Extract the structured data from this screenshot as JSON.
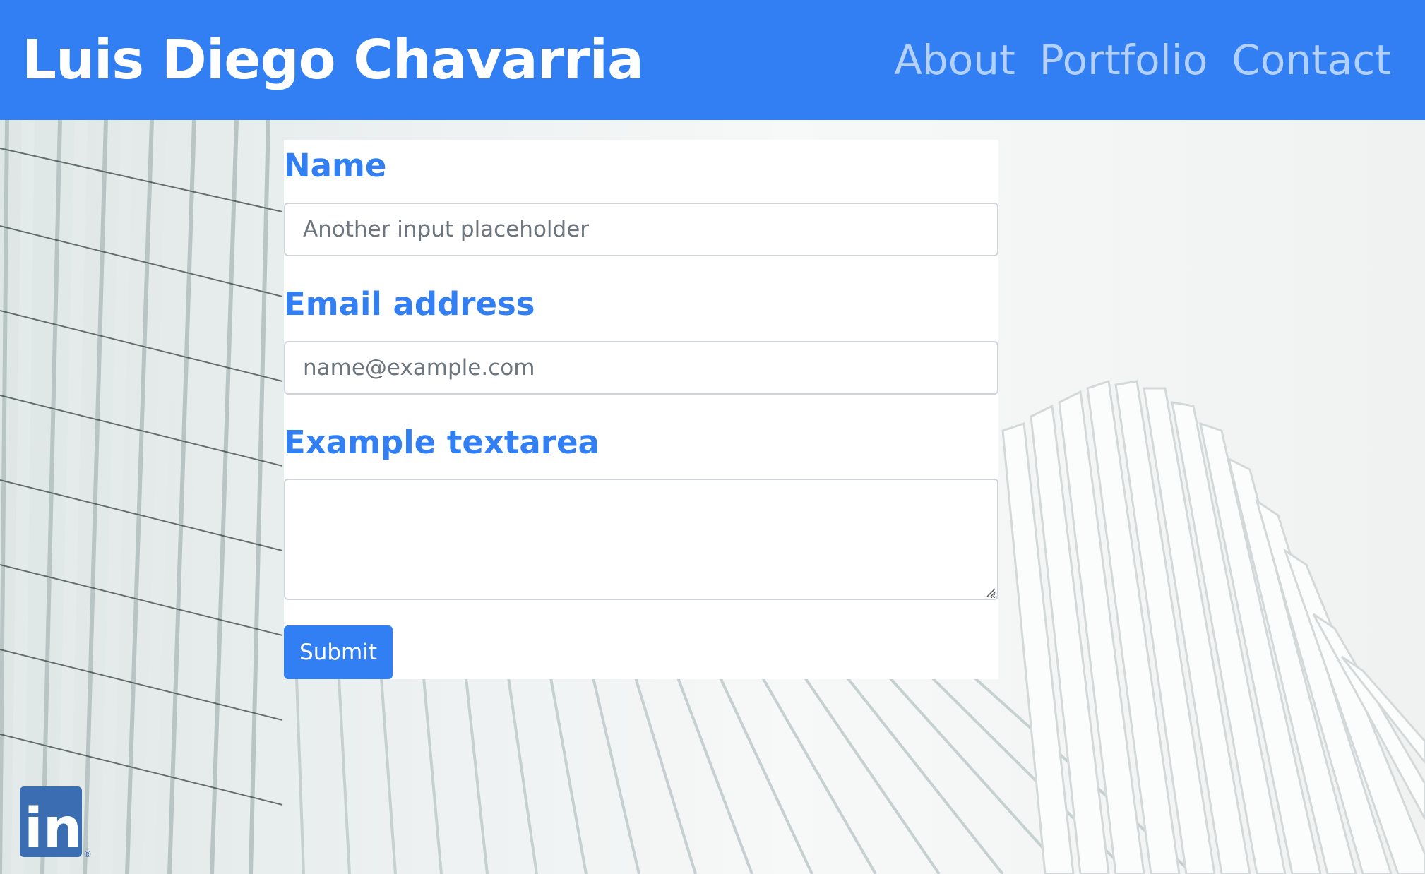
{
  "header": {
    "brand": "Luis Diego Chavarria",
    "nav": [
      {
        "label": "About"
      },
      {
        "label": "Portfolio"
      },
      {
        "label": "Contact"
      }
    ]
  },
  "form": {
    "name_label": "Name",
    "name_placeholder": "Another input placeholder",
    "email_label": "Email address",
    "email_placeholder": "name@example.com",
    "textarea_label": "Example textarea",
    "submit_label": "Submit"
  },
  "footer": {
    "linkedin_text": "in",
    "linkedin_icon": "linkedin-icon"
  },
  "colors": {
    "primary": "#327ff4",
    "nav_link": "#b3d1fb",
    "linkedin": "#3b6db3"
  }
}
